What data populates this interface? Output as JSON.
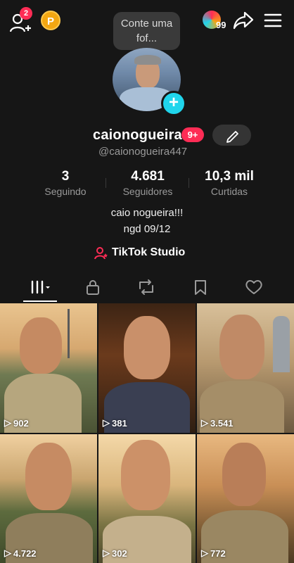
{
  "header": {
    "friend_badge": "2",
    "coin_label": "P",
    "note_text": "Conte uma fof...",
    "story_count": "99"
  },
  "profile": {
    "username": "caionogueira",
    "level_badge": "9+",
    "handle": "@caionogueira447",
    "bio_line1": "caio nogueira!!!",
    "bio_line2": "ngd 09/12",
    "studio_label": "TikTok Studio"
  },
  "stats": [
    {
      "value": "3",
      "label": "Seguindo"
    },
    {
      "value": "4.681",
      "label": "Seguidores"
    },
    {
      "value": "10,3 mil",
      "label": "Curtidas"
    }
  ],
  "tabs": [
    "videos-grid-icon",
    "lock-icon",
    "repost-icon",
    "bookmark-icon",
    "heart-icon"
  ],
  "videos": [
    {
      "views": "902"
    },
    {
      "views": "381"
    },
    {
      "views": "3.541"
    },
    {
      "views": "4.722"
    },
    {
      "views": "302"
    },
    {
      "views": "772"
    }
  ],
  "colors": {
    "background": "#161616",
    "accent_red": "#fe2c55",
    "accent_cyan": "#20d5ec",
    "coin": "#f3a712"
  }
}
